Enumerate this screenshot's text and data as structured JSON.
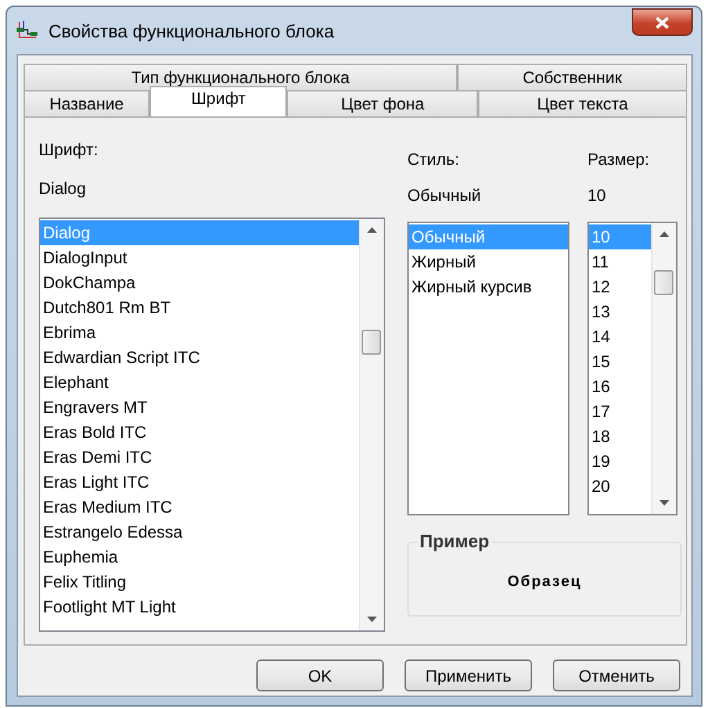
{
  "window": {
    "title": "Свойства функционального блока"
  },
  "tab_rows": [
    {
      "tabs": [
        {
          "label": "Тип функционального блока",
          "selected": false
        },
        {
          "label": "Собственник",
          "selected": false
        }
      ]
    },
    {
      "tabs": [
        {
          "label": "Название",
          "selected": false
        },
        {
          "label": "Шрифт",
          "selected": true
        },
        {
          "label": "Цвет фона",
          "selected": false
        },
        {
          "label": "Цвет текста",
          "selected": false
        }
      ]
    }
  ],
  "font": {
    "label": "Шрифт:",
    "value": "Dialog",
    "items": [
      {
        "label": "Dialog",
        "selected": true
      },
      {
        "label": "DialogInput",
        "selected": false
      },
      {
        "label": "DokChampa",
        "selected": false
      },
      {
        "label": "Dutch801 Rm BT",
        "selected": false
      },
      {
        "label": "Ebrima",
        "selected": false
      },
      {
        "label": "Edwardian Script ITC",
        "selected": false
      },
      {
        "label": "Elephant",
        "selected": false
      },
      {
        "label": "Engravers MT",
        "selected": false
      },
      {
        "label": "Eras Bold ITC",
        "selected": false
      },
      {
        "label": "Eras Demi ITC",
        "selected": false
      },
      {
        "label": "Eras Light ITC",
        "selected": false
      },
      {
        "label": "Eras Medium ITC",
        "selected": false
      },
      {
        "label": "Estrangelo Edessa",
        "selected": false
      },
      {
        "label": "Euphemia",
        "selected": false
      },
      {
        "label": "Felix Titling",
        "selected": false
      },
      {
        "label": "Footlight MT Light",
        "selected": false
      }
    ]
  },
  "style": {
    "label": "Стиль:",
    "value": "Обычный",
    "items": [
      {
        "label": "Обычный",
        "selected": true
      },
      {
        "label": "Жирный",
        "selected": false
      },
      {
        "label": "Жирный курсив",
        "selected": false
      }
    ]
  },
  "size": {
    "label": "Размер:",
    "value": "10",
    "items": [
      {
        "label": "10",
        "selected": true
      },
      {
        "label": "11",
        "selected": false
      },
      {
        "label": "12",
        "selected": false
      },
      {
        "label": "13",
        "selected": false
      },
      {
        "label": "14",
        "selected": false
      },
      {
        "label": "15",
        "selected": false
      },
      {
        "label": "16",
        "selected": false
      },
      {
        "label": "17",
        "selected": false
      },
      {
        "label": "18",
        "selected": false
      },
      {
        "label": "19",
        "selected": false
      },
      {
        "label": "20",
        "selected": false
      }
    ]
  },
  "preview": {
    "title": "Пример",
    "text": "Образец"
  },
  "buttons": [
    "OK",
    "Применить",
    "Отменить"
  ]
}
